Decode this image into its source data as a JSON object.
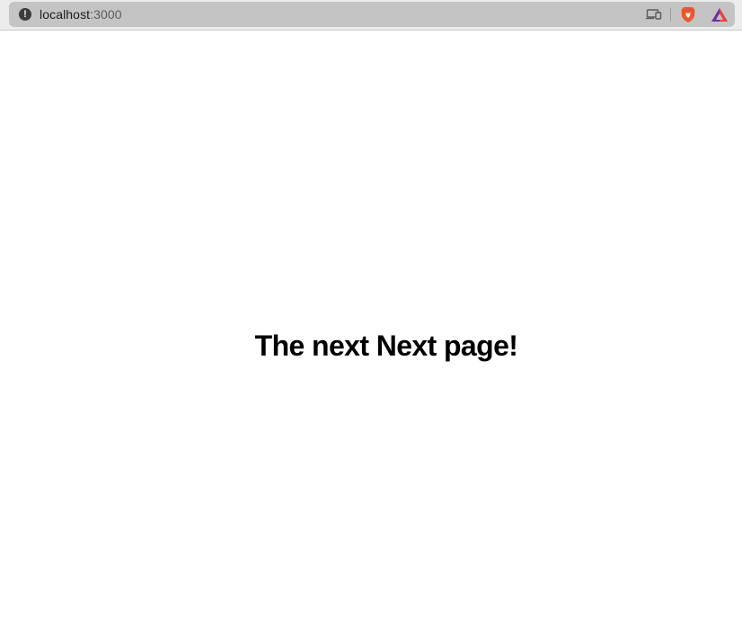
{
  "browser": {
    "address_bar": {
      "host": "localhost",
      "port": ":3000",
      "security_icon": "info-warning-icon"
    },
    "toolbar_icons": [
      "cast-icon",
      "brave-shields-icon",
      "brave-rewards-icon"
    ],
    "colors": {
      "toolbar_bg": "#ececec",
      "address_bar_bg": "#c4c4c4",
      "brave_orange": "#f0532a",
      "rewards_purple": "#6b2fa0"
    }
  },
  "page": {
    "heading": "The next Next page!"
  }
}
